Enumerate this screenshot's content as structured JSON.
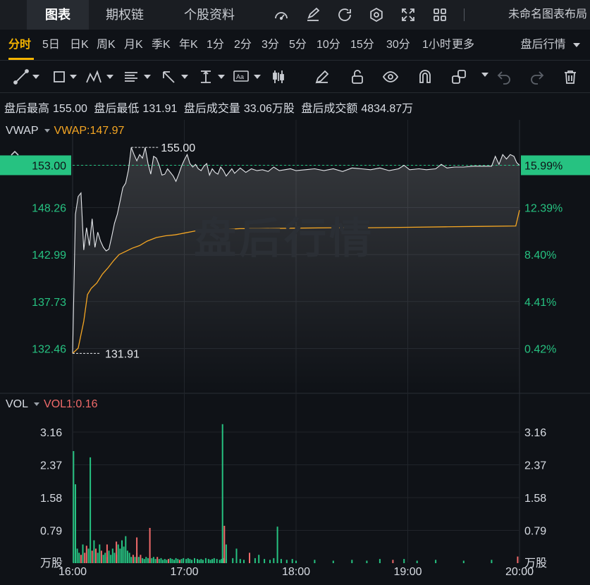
{
  "tabs": [
    "图表",
    "期权链",
    "个股资料"
  ],
  "layout_name": "未命名图表布局",
  "toolbar_icons": [
    "gauge-icon",
    "edit-icon",
    "refresh-icon",
    "settings-icon",
    "fullscreen-icon",
    "grid-icon"
  ],
  "periods": [
    "分时",
    "5日",
    "日K",
    "周K",
    "月K",
    "季K",
    "年K",
    "1分",
    "2分",
    "3分",
    "5分",
    "10分",
    "15分",
    "30分",
    "1小时",
    "更多"
  ],
  "active_period": "分时",
  "session": "盘后行情",
  "draw_tools": [
    "line-tool-icon",
    "rect-tool-icon",
    "pattern-tool-icon",
    "fib-tool-icon",
    "arrow-tool-icon",
    "measure-tool-icon",
    "text-tool-icon",
    "candle-tool-icon",
    "pencil-icon",
    "lock-icon",
    "eye-icon",
    "magnet-icon",
    "link-icon",
    "undo-icon",
    "redo-icon",
    "trash-icon"
  ],
  "stats": {
    "high_label": "盘后最高",
    "high": "155.00",
    "low_label": "盘后最低",
    "low": "131.91",
    "volume_label": "盘后成交量",
    "volume": "33.06万股",
    "turnover_label": "盘后成交额",
    "turnover": "4834.87万"
  },
  "vwap_legend": {
    "name": "VWAP",
    "value": "VWAP:147.97"
  },
  "vol_legend": {
    "name": "VOL",
    "value": "VOL1:0.16"
  },
  "watermark": "盘后行情",
  "colors": {
    "up": "#26c281",
    "down": "#f06a6a",
    "vwap": "#f5a623",
    "price": "#e6e8ec",
    "accent": "#f5b400",
    "bg": "#0f1217"
  },
  "chart_data": {
    "type": "line",
    "price_axis": {
      "ticks": [
        "148.26",
        "142.99",
        "137.73",
        "132.46"
      ],
      "pct_ticks": [
        "12.39%",
        "8.40%",
        "4.41%",
        "0.42%"
      ],
      "ylim": [
        130.6,
        157.7
      ]
    },
    "current_price": "153.00",
    "current_pct": "15.99%",
    "max_label": "155.00",
    "min_label": "131.91",
    "time_ticks": [
      "16:00",
      "17:00",
      "18:00",
      "19:00",
      "20:00"
    ],
    "time_range": [
      0,
      240
    ],
    "price_series": [
      [
        0,
        131.91
      ],
      [
        1.5,
        147.5
      ],
      [
        3,
        149.5
      ],
      [
        4.5,
        149.9
      ],
      [
        6,
        143.5
      ],
      [
        7.5,
        146.0
      ],
      [
        9,
        144.0
      ],
      [
        10.5,
        147.0
      ],
      [
        12,
        143.8
      ],
      [
        13.5,
        145.5
      ],
      [
        15,
        144.5
      ],
      [
        16.5,
        143.8
      ],
      [
        18,
        143.4
      ],
      [
        19.5,
        143.6
      ],
      [
        21,
        145.0
      ],
      [
        22.5,
        146.5
      ],
      [
        24,
        147.5
      ],
      [
        25.5,
        149.0
      ],
      [
        27,
        150.5
      ],
      [
        28.5,
        151.0
      ],
      [
        30,
        152.5
      ],
      [
        31.5,
        155.0
      ],
      [
        33,
        154.2
      ],
      [
        34.5,
        153.5
      ],
      [
        36,
        154.2
      ],
      [
        37.5,
        153.8
      ],
      [
        39,
        155.0
      ],
      [
        40.5,
        153.2
      ],
      [
        42,
        152.0
      ],
      [
        43.5,
        154.0
      ],
      [
        45,
        153.8
      ],
      [
        46.5,
        153.0
      ],
      [
        48,
        151.9
      ],
      [
        49.5,
        152.0
      ],
      [
        51,
        152.6
      ],
      [
        52.5,
        152.2
      ],
      [
        54,
        151.8
      ],
      [
        55.5,
        151.2
      ],
      [
        57,
        152.0
      ],
      [
        58.5,
        152.9
      ],
      [
        60,
        153.6
      ],
      [
        61.5,
        154.2
      ],
      [
        63,
        153.2
      ],
      [
        64.5,
        152.8
      ],
      [
        66,
        153.1
      ],
      [
        67.5,
        152.6
      ],
      [
        69,
        152.4
      ],
      [
        70.5,
        152.9
      ],
      [
        72,
        153.2
      ],
      [
        73.5,
        151.9
      ],
      [
        75,
        152.6
      ],
      [
        76.5,
        152.2
      ],
      [
        78,
        152.0
      ],
      [
        79.5,
        152.8
      ],
      [
        81,
        152.4
      ],
      [
        82.5,
        151.8
      ],
      [
        84,
        152.2
      ],
      [
        85.5,
        152.6
      ],
      [
        87,
        152.1
      ],
      [
        88.5,
        152.4
      ],
      [
        90,
        152.7
      ],
      [
        93,
        152.2
      ],
      [
        96,
        152.6
      ],
      [
        99,
        152.4
      ],
      [
        102,
        152.5
      ],
      [
        105,
        152.3
      ],
      [
        108,
        152.8
      ],
      [
        111,
        152.4
      ],
      [
        114,
        152.5
      ],
      [
        117,
        152.6
      ],
      [
        120,
        152.4
      ],
      [
        125,
        152.5
      ],
      [
        130,
        152.6
      ],
      [
        135,
        152.4
      ],
      [
        140,
        152.6
      ],
      [
        145,
        152.3
      ],
      [
        150,
        152.7
      ],
      [
        155,
        152.6
      ],
      [
        160,
        152.5
      ],
      [
        165,
        152.7
      ],
      [
        170,
        152.4
      ],
      [
        175,
        152.6
      ],
      [
        178,
        153.0
      ],
      [
        181,
        152.5
      ],
      [
        186,
        152.6
      ],
      [
        190,
        152.5
      ],
      [
        195,
        152.6
      ],
      [
        198,
        153.1
      ],
      [
        201,
        152.7
      ],
      [
        205,
        152.8
      ],
      [
        210,
        152.8
      ],
      [
        215,
        152.9
      ],
      [
        220,
        152.9
      ],
      [
        225,
        152.9
      ],
      [
        227,
        154.0
      ],
      [
        229,
        153.1
      ],
      [
        231,
        154.2
      ],
      [
        233,
        153.7
      ],
      [
        235,
        154.2
      ],
      [
        237,
        154.0
      ],
      [
        238.5,
        153.3
      ],
      [
        240,
        153.0
      ]
    ],
    "vwap_series": [
      [
        0,
        131.91
      ],
      [
        3,
        132.5
      ],
      [
        6,
        135.5
      ],
      [
        8,
        138.5
      ],
      [
        10,
        139.2
      ],
      [
        13,
        139.8
      ],
      [
        16,
        140.8
      ],
      [
        19,
        141.5
      ],
      [
        22,
        142.3
      ],
      [
        25,
        143.0
      ],
      [
        28,
        143.3
      ],
      [
        32,
        143.7
      ],
      [
        36,
        144.0
      ],
      [
        40,
        144.5
      ],
      [
        45,
        144.9
      ],
      [
        50,
        145.1
      ],
      [
        55,
        145.2
      ],
      [
        60,
        145.4
      ],
      [
        65,
        145.6
      ],
      [
        70,
        145.8
      ],
      [
        75,
        145.8
      ],
      [
        80,
        145.8
      ],
      [
        90,
        145.9
      ],
      [
        100,
        145.9
      ],
      [
        120,
        145.95
      ],
      [
        140,
        146.0
      ],
      [
        160,
        146.0
      ],
      [
        180,
        146.05
      ],
      [
        200,
        146.1
      ],
      [
        220,
        146.15
      ],
      [
        238,
        146.2
      ],
      [
        240,
        147.97
      ]
    ],
    "volume_axis": {
      "ticks": [
        "3.16",
        "2.37",
        "1.58",
        "0.79"
      ],
      "unit": "万股",
      "ylim": [
        0,
        3.55
      ]
    },
    "volume_series": [
      {
        "t": 0.5,
        "v": 2.7,
        "d": "up"
      },
      {
        "t": 1.5,
        "v": 1.9,
        "d": "up"
      },
      {
        "t": 2.5,
        "v": 0.35,
        "d": "up"
      },
      {
        "t": 3.5,
        "v": 0.25,
        "d": "up"
      },
      {
        "t": 4.5,
        "v": 0.2,
        "d": "down"
      },
      {
        "t": 5.5,
        "v": 0.45,
        "d": "up"
      },
      {
        "t": 6.5,
        "v": 0.25,
        "d": "down"
      },
      {
        "t": 7.5,
        "v": 0.42,
        "d": "down"
      },
      {
        "t": 8.5,
        "v": 0.35,
        "d": "up"
      },
      {
        "t": 9.5,
        "v": 2.55,
        "d": "up"
      },
      {
        "t": 10.5,
        "v": 0.3,
        "d": "down"
      },
      {
        "t": 11.5,
        "v": 0.55,
        "d": "up"
      },
      {
        "t": 12.5,
        "v": 0.35,
        "d": "down"
      },
      {
        "t": 13.5,
        "v": 0.25,
        "d": "up"
      },
      {
        "t": 14.5,
        "v": 0.45,
        "d": "up"
      },
      {
        "t": 15.5,
        "v": 0.3,
        "d": "down"
      },
      {
        "t": 16.5,
        "v": 0.2,
        "d": "up"
      },
      {
        "t": 17.5,
        "v": 0.25,
        "d": "up"
      },
      {
        "t": 18.5,
        "v": 0.15,
        "d": "down"
      },
      {
        "t": 19.5,
        "v": 0.3,
        "d": "up"
      },
      {
        "t": 20.5,
        "v": 0.2,
        "d": "up"
      },
      {
        "t": 21.5,
        "v": 0.35,
        "d": "up"
      },
      {
        "t": 22.5,
        "v": 0.25,
        "d": "up"
      },
      {
        "t": 23.5,
        "v": 0.2,
        "d": "down"
      },
      {
        "t": 24.5,
        "v": 0.45,
        "d": "up"
      },
      {
        "t": 25.5,
        "v": 0.35,
        "d": "up"
      },
      {
        "t": 26.5,
        "v": 0.55,
        "d": "up"
      },
      {
        "t": 27.5,
        "v": 0.4,
        "d": "up"
      },
      {
        "t": 28.5,
        "v": 0.65,
        "d": "up"
      },
      {
        "t": 29.5,
        "v": 0.3,
        "d": "up"
      },
      {
        "t": 30.5,
        "v": 0.25,
        "d": "up"
      },
      {
        "t": 31.5,
        "v": 0.15,
        "d": "up"
      },
      {
        "t": 32.5,
        "v": 0.2,
        "d": "down"
      },
      {
        "t": 33.5,
        "v": 0.15,
        "d": "up"
      },
      {
        "t": 34.5,
        "v": 0.25,
        "d": "up"
      },
      {
        "t": 35.5,
        "v": 0.15,
        "d": "up"
      },
      {
        "t": 36.5,
        "v": 0.2,
        "d": "down"
      },
      {
        "t": 37.5,
        "v": 0.12,
        "d": "up"
      },
      {
        "t": 38.5,
        "v": 0.1,
        "d": "up"
      },
      {
        "t": 39.5,
        "v": 0.15,
        "d": "up"
      },
      {
        "t": 40.5,
        "v": 0.12,
        "d": "up"
      },
      {
        "t": 41.5,
        "v": 0.1,
        "d": "down"
      },
      {
        "t": 42.5,
        "v": 0.12,
        "d": "up"
      },
      {
        "t": 43.5,
        "v": 0.15,
        "d": "up"
      },
      {
        "t": 44.5,
        "v": 0.1,
        "d": "up"
      },
      {
        "t": 45.5,
        "v": 0.15,
        "d": "down"
      },
      {
        "t": 46.5,
        "v": 0.1,
        "d": "up"
      },
      {
        "t": 47.5,
        "v": 0.12,
        "d": "up"
      },
      {
        "t": 48.5,
        "v": 0.08,
        "d": "up"
      },
      {
        "t": 49.5,
        "v": 0.1,
        "d": "up"
      },
      {
        "t": 50.5,
        "v": 0.08,
        "d": "up"
      },
      {
        "t": 51.5,
        "v": 0.1,
        "d": "down"
      },
      {
        "t": 52.5,
        "v": 0.12,
        "d": "up"
      },
      {
        "t": 53.5,
        "v": 0.1,
        "d": "up"
      },
      {
        "t": 54.5,
        "v": 0.08,
        "d": "up"
      },
      {
        "t": 55.5,
        "v": 0.12,
        "d": "up"
      },
      {
        "t": 56.5,
        "v": 0.1,
        "d": "up"
      },
      {
        "t": 57.5,
        "v": 0.08,
        "d": "down"
      },
      {
        "t": 58.5,
        "v": 0.1,
        "d": "up"
      },
      {
        "t": 59.5,
        "v": 0.12,
        "d": "up"
      },
      {
        "t": 61,
        "v": 0.1,
        "d": "up"
      },
      {
        "t": 62,
        "v": 0.12,
        "d": "up"
      },
      {
        "t": 63,
        "v": 0.1,
        "d": "up"
      },
      {
        "t": 64,
        "v": 0.08,
        "d": "up"
      },
      {
        "t": 65.5,
        "v": 0.12,
        "d": "up"
      },
      {
        "t": 67,
        "v": 0.1,
        "d": "up"
      },
      {
        "t": 68,
        "v": 0.08,
        "d": "up"
      },
      {
        "t": 69,
        "v": 0.1,
        "d": "up"
      },
      {
        "t": 70,
        "v": 0.08,
        "d": "up"
      },
      {
        "t": 71.5,
        "v": 0.12,
        "d": "up"
      },
      {
        "t": 73,
        "v": 0.1,
        "d": "up"
      },
      {
        "t": 74,
        "v": 0.08,
        "d": "up"
      },
      {
        "t": 75,
        "v": 0.1,
        "d": "up"
      },
      {
        "t": 76,
        "v": 0.12,
        "d": "up"
      },
      {
        "t": 77.5,
        "v": 0.1,
        "d": "up"
      },
      {
        "t": 79,
        "v": 0.08,
        "d": "up"
      },
      {
        "t": 80,
        "v": 0.1,
        "d": "up"
      },
      {
        "t": 81,
        "v": 0.12,
        "d": "up"
      },
      {
        "t": 82.5,
        "v": 0.1,
        "d": "up"
      },
      {
        "t": 41.5,
        "v": 0.85,
        "d": "down"
      },
      {
        "t": 34.5,
        "v": 0.62,
        "d": "down"
      },
      {
        "t": 18.5,
        "v": 0.45,
        "d": "down"
      },
      {
        "t": 23.5,
        "v": 0.52,
        "d": "down"
      },
      {
        "t": 80.5,
        "v": 3.35,
        "d": "up"
      },
      {
        "t": 81.5,
        "v": 0.9,
        "d": "down"
      },
      {
        "t": 82.5,
        "v": 0.45,
        "d": "up"
      },
      {
        "t": 86,
        "v": 0.12,
        "d": "up"
      },
      {
        "t": 88,
        "v": 0.35,
        "d": "up"
      },
      {
        "t": 90,
        "v": 0.1,
        "d": "up"
      },
      {
        "t": 92,
        "v": 0.08,
        "d": "up"
      },
      {
        "t": 95,
        "v": 0.25,
        "d": "down"
      },
      {
        "t": 98,
        "v": 0.12,
        "d": "up"
      },
      {
        "t": 100,
        "v": 0.2,
        "d": "up"
      },
      {
        "t": 103,
        "v": 0.1,
        "d": "up"
      },
      {
        "t": 106,
        "v": 0.08,
        "d": "up"
      },
      {
        "t": 108,
        "v": 0.12,
        "d": "up"
      },
      {
        "t": 110,
        "v": 0.88,
        "d": "up"
      },
      {
        "t": 112,
        "v": 0.1,
        "d": "up"
      },
      {
        "t": 115,
        "v": 0.08,
        "d": "up"
      },
      {
        "t": 118,
        "v": 0.1,
        "d": "up"
      },
      {
        "t": 120,
        "v": 0.06,
        "d": "up"
      },
      {
        "t": 130,
        "v": 0.08,
        "d": "up"
      },
      {
        "t": 140,
        "v": 0.06,
        "d": "up"
      },
      {
        "t": 150,
        "v": 0.08,
        "d": "up"
      },
      {
        "t": 158,
        "v": 0.06,
        "d": "up"
      },
      {
        "t": 165,
        "v": 0.1,
        "d": "up"
      },
      {
        "t": 172,
        "v": 0.08,
        "d": "down"
      },
      {
        "t": 178,
        "v": 0.1,
        "d": "up"
      },
      {
        "t": 185,
        "v": 0.06,
        "d": "up"
      },
      {
        "t": 195,
        "v": 0.08,
        "d": "up"
      },
      {
        "t": 210,
        "v": 0.06,
        "d": "up"
      },
      {
        "t": 225,
        "v": 0.08,
        "d": "up"
      },
      {
        "t": 239,
        "v": 0.16,
        "d": "down"
      }
    ]
  }
}
